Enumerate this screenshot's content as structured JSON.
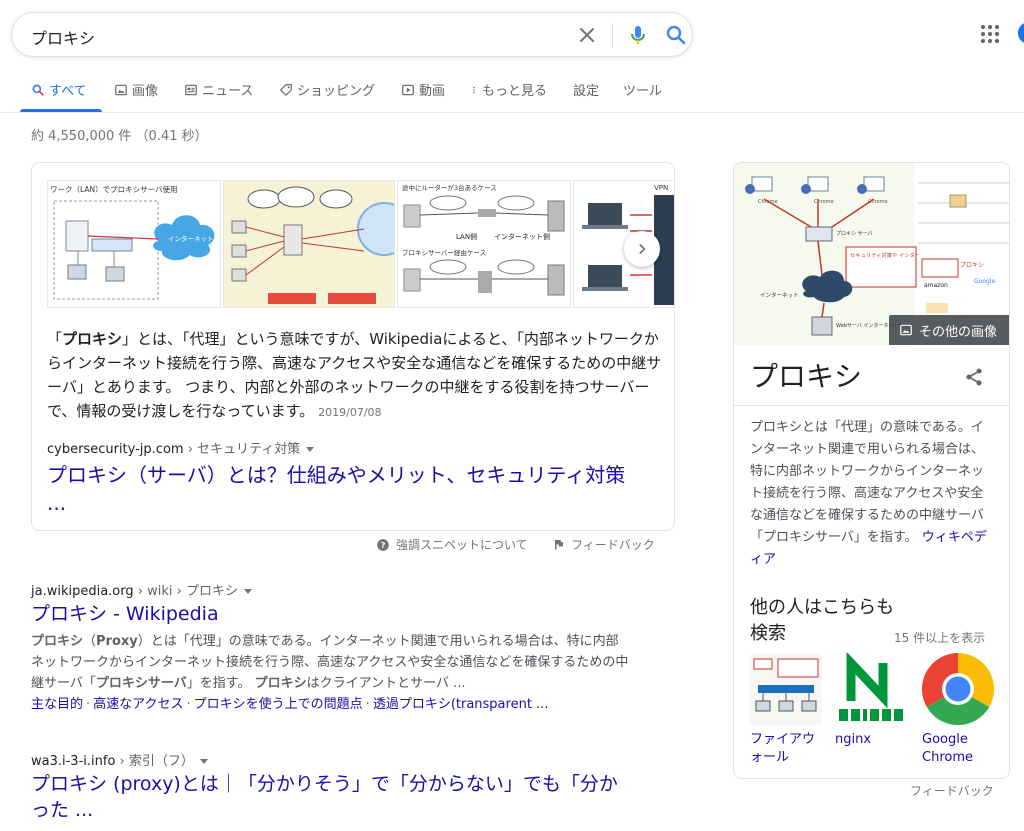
{
  "search": {
    "query": "プロキシ"
  },
  "tabs": [
    {
      "label": "すべて",
      "icon": "search-icon"
    },
    {
      "label": "画像",
      "icon": "image-icon"
    },
    {
      "label": "ニュース",
      "icon": "news-icon"
    },
    {
      "label": "ショッピング",
      "icon": "tag-icon"
    },
    {
      "label": "動画",
      "icon": "play-icon"
    },
    {
      "label": "もっと見る",
      "icon": "more-vert-icon"
    },
    {
      "label": "設定",
      "icon": ""
    },
    {
      "label": "ツール",
      "icon": ""
    }
  ],
  "stats": "約 4,550,000 件 （0.41 秒）",
  "snippet": {
    "text_lead": "「",
    "text_bold": "プロキシ",
    "text_rest": "」とは、「代理」という意味ですが、Wikipediaによると、「内部ネットワークからインターネット接続を行う際、高速なアクセスや安全な通信などを確保するための中継サーバ」とあります。 つまり、内部と外部のネットワークの中継をする役割を持つサーバーで、情報の受け渡しを行なっています。",
    "date": "2019/07/08",
    "cite_domain": "cybersecurity-jp.com",
    "cite_path": " › セキュリティ対策",
    "title": "プロキシ（サーバ）とは？仕組みやメリット、セキュリティ対策 ...",
    "about_label": "強調スニペットについて",
    "feedback_label": "フィードバック",
    "images": {
      "img1_label": "ワーク（LAN）でプロキシサーバ使用",
      "img1_cloud": "インターネット",
      "img3_label1": "途中にルーターが3台あるケース",
      "img3_lan": "LAN側",
      "img3_inet": "インターネット側",
      "img3_label2": "プロキシサーバー経由ケース",
      "img4_label": "VPN"
    }
  },
  "results": [
    {
      "cite_domain": "ja.wikipedia.org",
      "cite_path": " › wiki › プロキシ",
      "title": "プロキシ - Wikipedia",
      "desc_b1": "プロキシ",
      "desc_1": "（",
      "desc_b2": "Proxy",
      "desc_2": "）とは「代理」の意味である。インターネット関連で用いられる場合は、特に内部ネットワークからインターネット接続を行う際、高速なアクセスや安全な通信などを確保するための中継サーバ「",
      "desc_b3": "プロキシサーバ",
      "desc_3": "」を指す。 ",
      "desc_b4": "プロキシ",
      "desc_4": "はクライアントとサーバ ...",
      "sitelinks": [
        "主な目的",
        "高速なアクセス",
        "プロキシを使う上での問題点",
        "透過プロキシ(transparent ..."
      ]
    },
    {
      "cite_domain": "wa3.i-3-i.info",
      "cite_path": " › 索引（フ）",
      "title": "プロキシ (proxy)とは｜「分かりそう」で「分からない」でも「分かった ..."
    }
  ],
  "knowledge_panel": {
    "title": "プロキシ",
    "more_images": "その他の画像",
    "desc": "プロキシとは「代理」の意味である。インターネット関連で用いられる場合は、特に内部ネットワークからインターネット接続を行う際、高速なアクセスや安全な通信などを確保するための中継サーバ「プロキシサーバ」を指す。",
    "source_link": "ウィキペディア",
    "related_title": "他の人はこちらも検索",
    "related_more": "15 件以上を表示",
    "related": [
      {
        "label": "ファイアウォール"
      },
      {
        "label": "nginx"
      },
      {
        "label": "Google Chrome"
      }
    ],
    "feedback": "フィードバック",
    "image_text": {
      "chrome": "Chrome",
      "proxy": "プロキシ\nサーバ",
      "internet": "インターネット",
      "web": "Webサーバ\nインターネットサイト",
      "callout": "セキュリティ対策や\nインターネット回線の\n帯域節約、性能向上\nなどの効果があります",
      "right_caption": "プロキシ",
      "google": "Google",
      "amazon": "amazon"
    }
  },
  "colors": {
    "link": "#1a0dab",
    "accent": "#1a73e8",
    "text": "#202124",
    "muted": "#70757a"
  }
}
